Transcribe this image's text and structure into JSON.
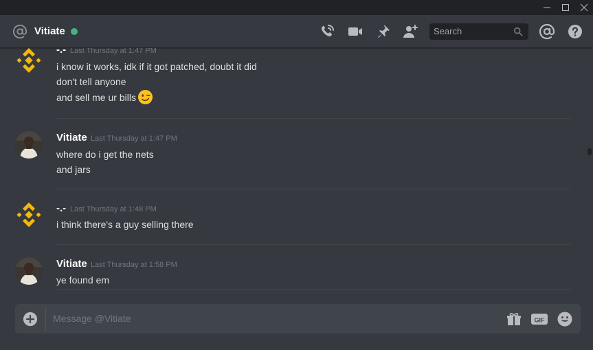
{
  "window": {
    "controls": [
      "minimize",
      "maximize",
      "close"
    ]
  },
  "header": {
    "channel_icon": "at-icon",
    "username": "Vitiate",
    "status_color": "#43b581",
    "icons": [
      "call-icon",
      "video-icon",
      "pin-icon",
      "add-friend-icon"
    ],
    "search_placeholder": "Search",
    "right_icons": [
      "mentions-icon",
      "help-icon"
    ]
  },
  "messages": [
    {
      "author": "-.-",
      "avatar": "binance-logo",
      "timestamp": "Last Thursday at 1:47 PM",
      "lines": [
        "i know it works, idk if it got patched, doubt it did",
        "don't tell anyone",
        "and sell me ur bills"
      ],
      "emoji": "winking-face-emoji"
    },
    {
      "author": "Vitiate",
      "avatar": "user-photo",
      "timestamp": "Last Thursday at 1:47 PM",
      "lines": [
        "where do i get the nets",
        "and jars"
      ]
    },
    {
      "author": "-.-",
      "avatar": "binance-logo",
      "timestamp": "Last Thursday at 1:48 PM",
      "lines": [
        "i think there's a guy selling there"
      ]
    },
    {
      "author": "Vitiate",
      "avatar": "user-photo",
      "timestamp": "Last Thursday at 1:58 PM",
      "lines": [
        "ye found em"
      ]
    }
  ],
  "composer": {
    "placeholder": "Message @Vitiate",
    "icons": [
      "attach-plus-icon",
      "gift-icon",
      "gif-icon",
      "emoji-icon"
    ]
  },
  "colors": {
    "background": "#36393f",
    "titlebar": "#202225",
    "composer": "#40444b",
    "binance_yellow": "#f0b90b"
  }
}
